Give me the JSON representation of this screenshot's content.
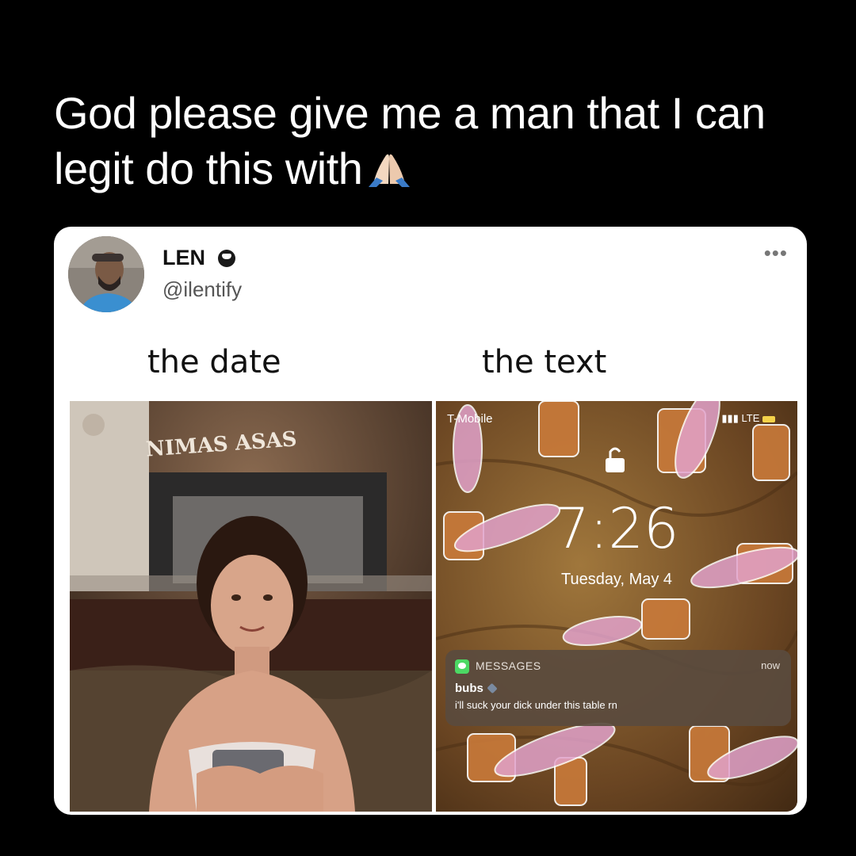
{
  "caption": {
    "line1": "God please give me a man that I can",
    "line2": "legit do this with",
    "emoji_icon": "praying-hands-emoji"
  },
  "tweet": {
    "name": "LEN",
    "handle": "@ilentify",
    "more": "•••",
    "left_label": "the date",
    "right_label": "the text"
  },
  "left_photo": {
    "sign_text": "NIMAS ASAS"
  },
  "lockscreen": {
    "carrier": "T-Mobile",
    "status_right": "LTE",
    "time": "7:26",
    "date": "Tuesday, May 4",
    "notification": {
      "app": "MESSAGES",
      "time": "now",
      "sender": "bubs",
      "body": "i'll suck your dick under this table rn"
    }
  },
  "colors": {
    "background": "#000000",
    "card": "#ffffff",
    "notification_bg": "#5a4b3e",
    "messages_green": "#4cd964"
  }
}
